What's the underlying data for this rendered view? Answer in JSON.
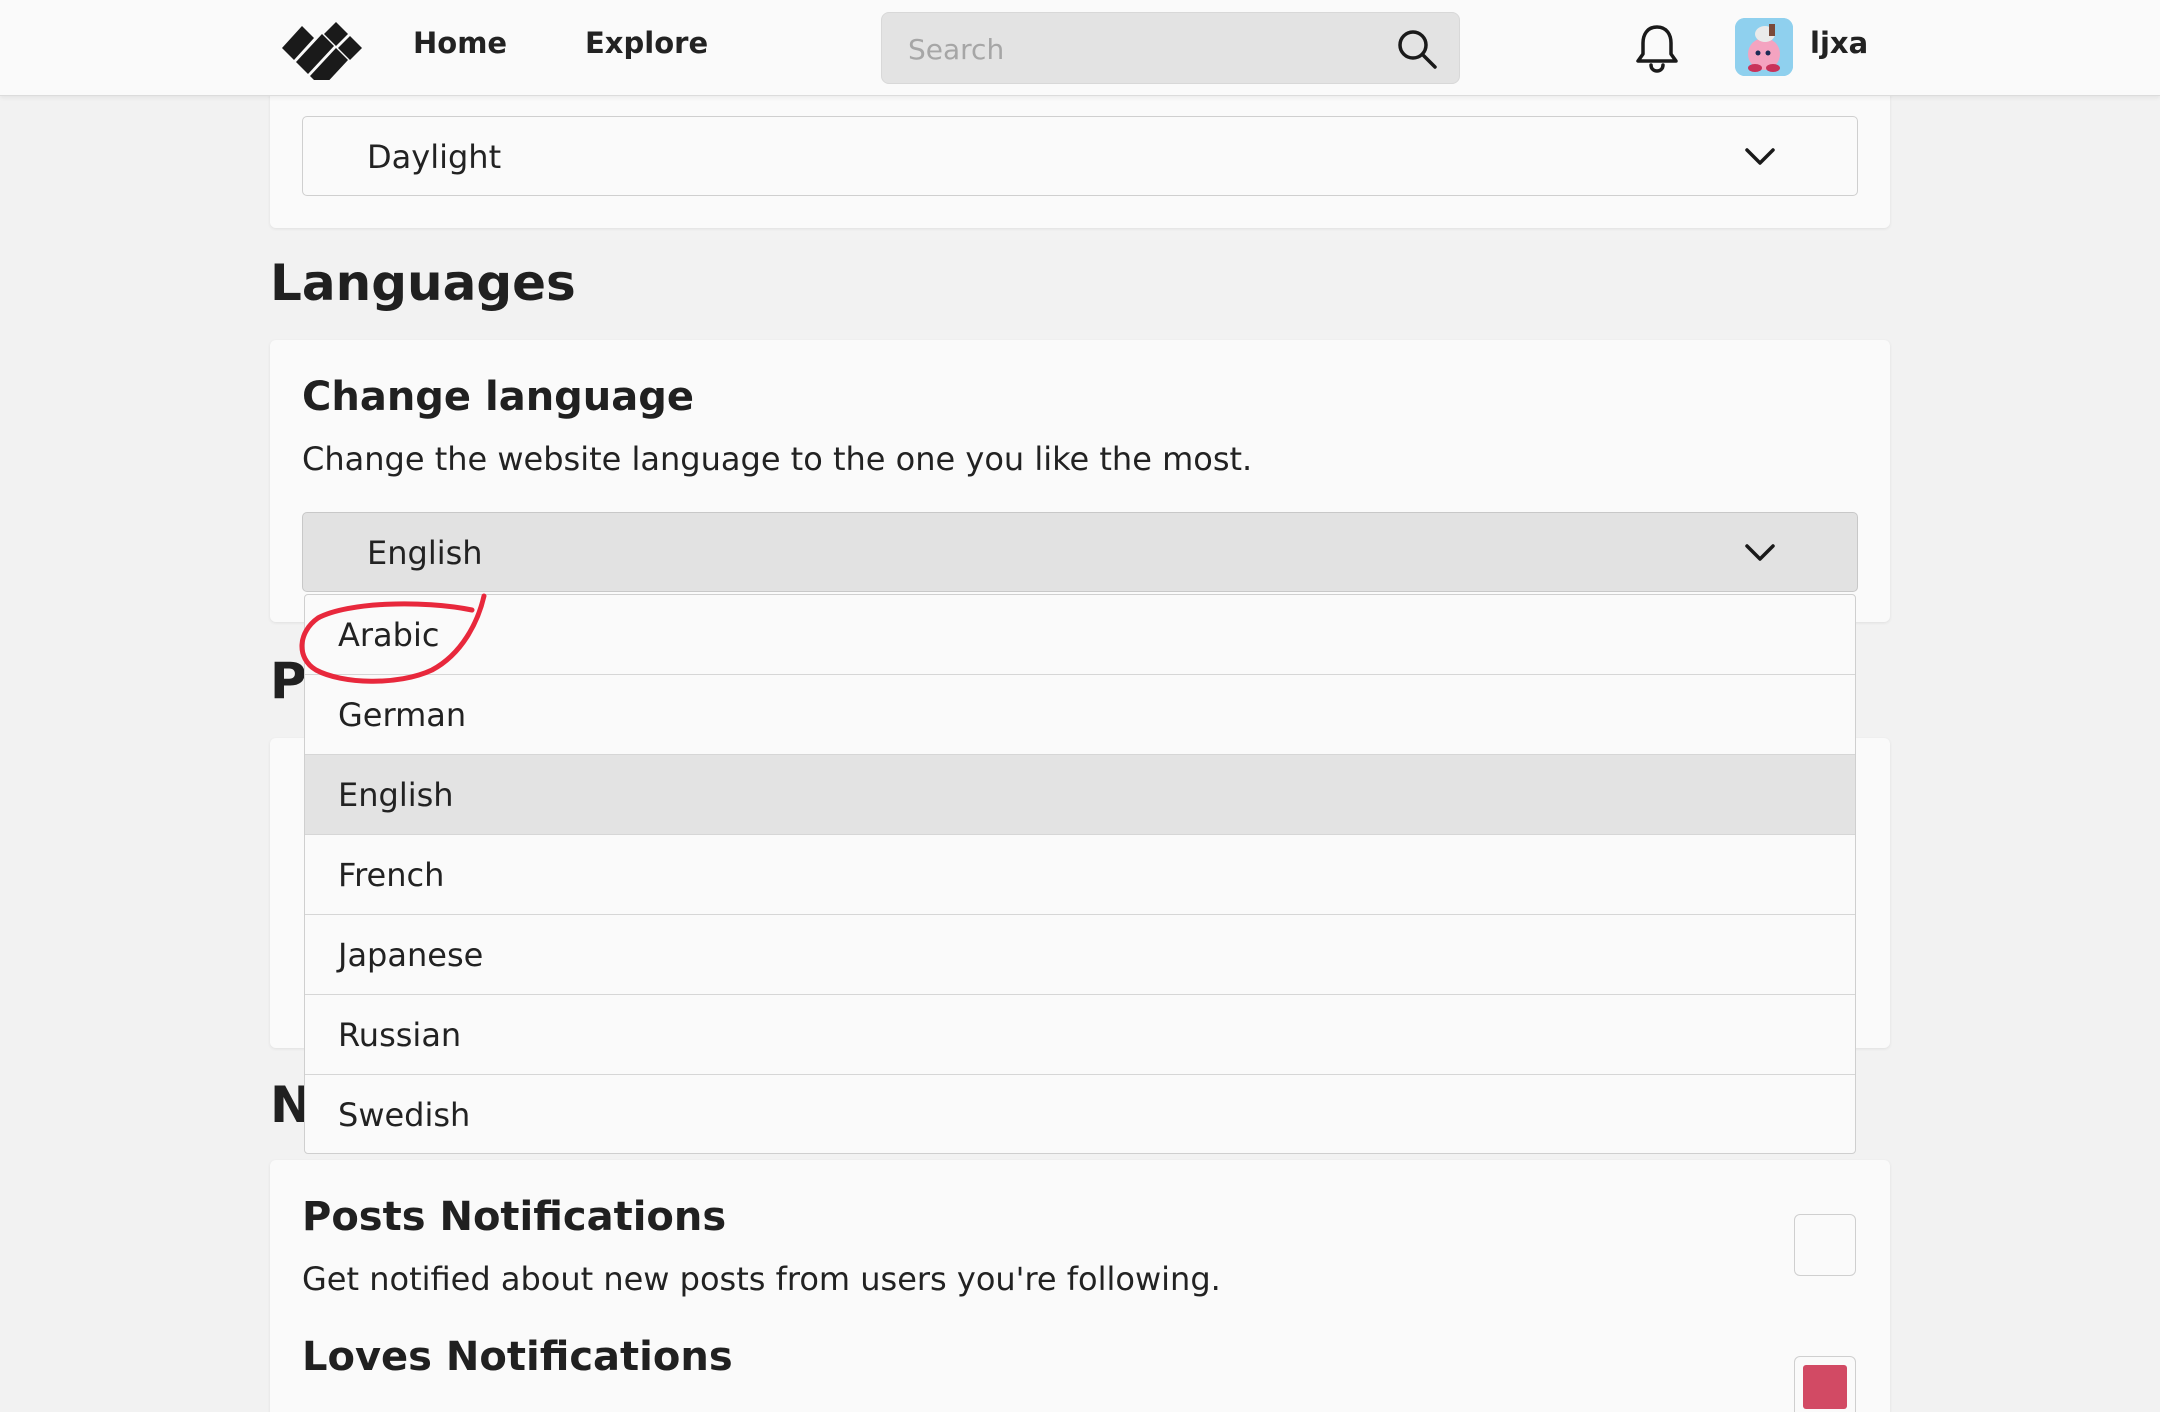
{
  "nav": {
    "home": "Home",
    "explore": "Explore",
    "search_placeholder": "Search",
    "username": "ljxa"
  },
  "theme": {
    "selected": "Daylight"
  },
  "languages": {
    "heading": "Languages",
    "card_title": "Change language",
    "card_desc": "Change the website language to the one you like the most.",
    "selected": "English",
    "options": [
      "Arabic",
      "German",
      "English",
      "French",
      "Japanese",
      "Russian",
      "Swedish"
    ]
  },
  "privacy": {
    "heading_partial": "P"
  },
  "notifications": {
    "heading_partial": "N",
    "posts_title": "Posts Notifications",
    "posts_desc": "Get notified about new posts from users you're following.",
    "posts_checked": false,
    "loves_title": "Loves Notifications",
    "loves_checked": true
  },
  "colors": {
    "accent_checkbox": "#d24a64",
    "annotation": "#e8283c"
  }
}
